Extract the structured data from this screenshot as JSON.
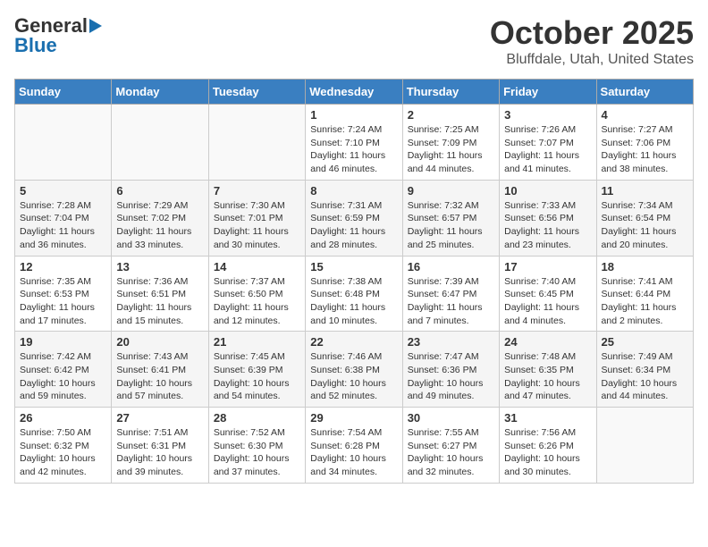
{
  "header": {
    "logo_general": "General",
    "logo_blue": "Blue",
    "month_title": "October 2025",
    "location": "Bluffdale, Utah, United States"
  },
  "days_of_week": [
    "Sunday",
    "Monday",
    "Tuesday",
    "Wednesday",
    "Thursday",
    "Friday",
    "Saturday"
  ],
  "weeks": [
    [
      {
        "num": "",
        "info": ""
      },
      {
        "num": "",
        "info": ""
      },
      {
        "num": "",
        "info": ""
      },
      {
        "num": "1",
        "info": "Sunrise: 7:24 AM\nSunset: 7:10 PM\nDaylight: 11 hours and 46 minutes."
      },
      {
        "num": "2",
        "info": "Sunrise: 7:25 AM\nSunset: 7:09 PM\nDaylight: 11 hours and 44 minutes."
      },
      {
        "num": "3",
        "info": "Sunrise: 7:26 AM\nSunset: 7:07 PM\nDaylight: 11 hours and 41 minutes."
      },
      {
        "num": "4",
        "info": "Sunrise: 7:27 AM\nSunset: 7:06 PM\nDaylight: 11 hours and 38 minutes."
      }
    ],
    [
      {
        "num": "5",
        "info": "Sunrise: 7:28 AM\nSunset: 7:04 PM\nDaylight: 11 hours and 36 minutes."
      },
      {
        "num": "6",
        "info": "Sunrise: 7:29 AM\nSunset: 7:02 PM\nDaylight: 11 hours and 33 minutes."
      },
      {
        "num": "7",
        "info": "Sunrise: 7:30 AM\nSunset: 7:01 PM\nDaylight: 11 hours and 30 minutes."
      },
      {
        "num": "8",
        "info": "Sunrise: 7:31 AM\nSunset: 6:59 PM\nDaylight: 11 hours and 28 minutes."
      },
      {
        "num": "9",
        "info": "Sunrise: 7:32 AM\nSunset: 6:57 PM\nDaylight: 11 hours and 25 minutes."
      },
      {
        "num": "10",
        "info": "Sunrise: 7:33 AM\nSunset: 6:56 PM\nDaylight: 11 hours and 23 minutes."
      },
      {
        "num": "11",
        "info": "Sunrise: 7:34 AM\nSunset: 6:54 PM\nDaylight: 11 hours and 20 minutes."
      }
    ],
    [
      {
        "num": "12",
        "info": "Sunrise: 7:35 AM\nSunset: 6:53 PM\nDaylight: 11 hours and 17 minutes."
      },
      {
        "num": "13",
        "info": "Sunrise: 7:36 AM\nSunset: 6:51 PM\nDaylight: 11 hours and 15 minutes."
      },
      {
        "num": "14",
        "info": "Sunrise: 7:37 AM\nSunset: 6:50 PM\nDaylight: 11 hours and 12 minutes."
      },
      {
        "num": "15",
        "info": "Sunrise: 7:38 AM\nSunset: 6:48 PM\nDaylight: 11 hours and 10 minutes."
      },
      {
        "num": "16",
        "info": "Sunrise: 7:39 AM\nSunset: 6:47 PM\nDaylight: 11 hours and 7 minutes."
      },
      {
        "num": "17",
        "info": "Sunrise: 7:40 AM\nSunset: 6:45 PM\nDaylight: 11 hours and 4 minutes."
      },
      {
        "num": "18",
        "info": "Sunrise: 7:41 AM\nSunset: 6:44 PM\nDaylight: 11 hours and 2 minutes."
      }
    ],
    [
      {
        "num": "19",
        "info": "Sunrise: 7:42 AM\nSunset: 6:42 PM\nDaylight: 10 hours and 59 minutes."
      },
      {
        "num": "20",
        "info": "Sunrise: 7:43 AM\nSunset: 6:41 PM\nDaylight: 10 hours and 57 minutes."
      },
      {
        "num": "21",
        "info": "Sunrise: 7:45 AM\nSunset: 6:39 PM\nDaylight: 10 hours and 54 minutes."
      },
      {
        "num": "22",
        "info": "Sunrise: 7:46 AM\nSunset: 6:38 PM\nDaylight: 10 hours and 52 minutes."
      },
      {
        "num": "23",
        "info": "Sunrise: 7:47 AM\nSunset: 6:36 PM\nDaylight: 10 hours and 49 minutes."
      },
      {
        "num": "24",
        "info": "Sunrise: 7:48 AM\nSunset: 6:35 PM\nDaylight: 10 hours and 47 minutes."
      },
      {
        "num": "25",
        "info": "Sunrise: 7:49 AM\nSunset: 6:34 PM\nDaylight: 10 hours and 44 minutes."
      }
    ],
    [
      {
        "num": "26",
        "info": "Sunrise: 7:50 AM\nSunset: 6:32 PM\nDaylight: 10 hours and 42 minutes."
      },
      {
        "num": "27",
        "info": "Sunrise: 7:51 AM\nSunset: 6:31 PM\nDaylight: 10 hours and 39 minutes."
      },
      {
        "num": "28",
        "info": "Sunrise: 7:52 AM\nSunset: 6:30 PM\nDaylight: 10 hours and 37 minutes."
      },
      {
        "num": "29",
        "info": "Sunrise: 7:54 AM\nSunset: 6:28 PM\nDaylight: 10 hours and 34 minutes."
      },
      {
        "num": "30",
        "info": "Sunrise: 7:55 AM\nSunset: 6:27 PM\nDaylight: 10 hours and 32 minutes."
      },
      {
        "num": "31",
        "info": "Sunrise: 7:56 AM\nSunset: 6:26 PM\nDaylight: 10 hours and 30 minutes."
      },
      {
        "num": "",
        "info": ""
      }
    ]
  ]
}
